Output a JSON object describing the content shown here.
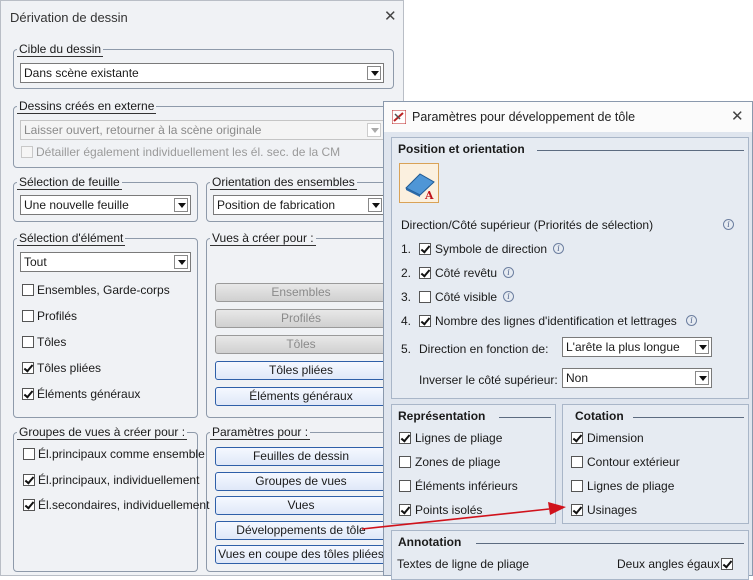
{
  "dialog1": {
    "title": "Dérivation de dessin",
    "target": {
      "label": "Cible du dessin",
      "value": "Dans scène existante"
    },
    "external": {
      "label": "Dessins créés en externe",
      "value": "Laisser ouvert, retourner à la scène originale",
      "detail_label": "Détailler également individuellement les él. sec. de la CM"
    },
    "sheet": {
      "label": "Sélection de feuille",
      "value": "Une nouvelle feuille"
    },
    "orientation": {
      "label": "Orientation des ensembles",
      "value": "Position de fabrication"
    },
    "element_selection": {
      "label": "Sélection d'élément",
      "value": "Tout",
      "items": [
        "Ensembles, Garde-corps",
        "Profilés",
        "Tôles",
        "Tôles pliées",
        "Éléments généraux"
      ]
    },
    "views_to_create": {
      "label": "Vues à créer pour :",
      "buttons": [
        "Ensembles",
        "Profilés",
        "Tôles",
        "Tôles pliées",
        "Éléments généraux"
      ]
    },
    "view_groups": {
      "label": "Groupes de vues à créer pour :",
      "items": [
        "Él.principaux comme ensemble",
        "Él.principaux, individuellement",
        "Él.secondaires, individuellement"
      ]
    },
    "params": {
      "label": "Paramètres pour :",
      "buttons": [
        "Feuilles de dessin",
        "Groupes de vues",
        "Vues",
        "Développements de tôle",
        "Vues en coupe des tôles pliées"
      ]
    }
  },
  "dialog2": {
    "title": "Paramètres pour développement de tôle",
    "position": {
      "header": "Position et orientation",
      "direction_label": "Direction/Côté supérieur (Priorités de sélection)",
      "items": [
        {
          "num": "1.",
          "label": "Symbole de direction"
        },
        {
          "num": "2.",
          "label": "Côté revêtu"
        },
        {
          "num": "3.",
          "label": "Côté visible"
        },
        {
          "num": "4.",
          "label": "Nombre des lignes d'identification et lettrages"
        }
      ],
      "direction_func": {
        "num": "5.",
        "label": "Direction en fonction de:",
        "value": "L'arête la plus longue"
      },
      "invert": {
        "label": "Inverser le côté supérieur:",
        "value": "Non"
      }
    },
    "representation": {
      "header": "Représentation",
      "items": [
        "Lignes de pliage",
        "Zones de pliage",
        "Éléments inférieurs",
        "Points isolés"
      ]
    },
    "cotation": {
      "header": "Cotation",
      "items": [
        "Dimension",
        "Contour extérieur",
        "Lignes de pliage",
        "Usinages"
      ]
    },
    "annotation": {
      "header": "Annotation",
      "left": "Textes de ligne de pliage",
      "right": "Deux angles égaux"
    }
  },
  "colors": {
    "arrow": "#d0121b",
    "accent": "#2e5fa8"
  }
}
